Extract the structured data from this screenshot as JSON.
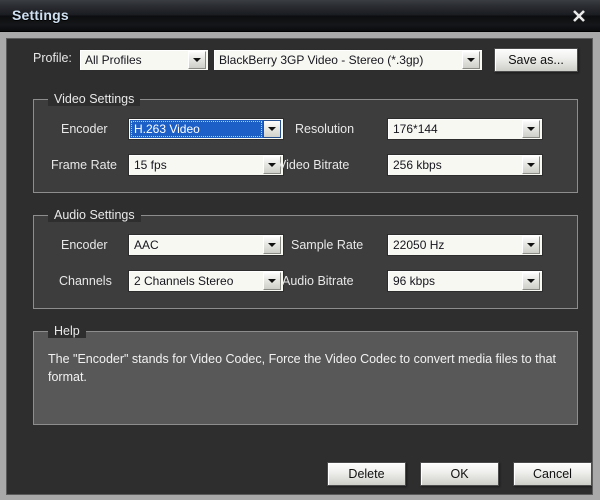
{
  "window": {
    "title": "Settings",
    "close_icon": "close-icon"
  },
  "profile": {
    "label": "Profile:",
    "filter_value": "All Profiles",
    "profile_value": "BlackBerry 3GP Video - Stereo (*.3gp)",
    "save_as_label": "Save as..."
  },
  "video_settings": {
    "title": "Video Settings",
    "encoder_label": "Encoder",
    "encoder_value": "H.263 Video",
    "resolution_label": "Resolution",
    "resolution_value": "176*144",
    "frame_rate_label": "Frame Rate",
    "frame_rate_value": "15 fps",
    "video_bitrate_label": "Video Bitrate",
    "video_bitrate_value": "256 kbps"
  },
  "audio_settings": {
    "title": "Audio Settings",
    "encoder_label": "Encoder",
    "encoder_value": "AAC",
    "sample_rate_label": "Sample Rate",
    "sample_rate_value": "22050 Hz",
    "channels_label": "Channels",
    "channels_value": "2 Channels Stereo",
    "audio_bitrate_label": "Audio Bitrate",
    "audio_bitrate_value": "96 kbps"
  },
  "help": {
    "title": "Help",
    "text": "The \"Encoder\" stands for Video Codec, Force the Video Codec to convert media files to that format."
  },
  "footer": {
    "delete_label": "Delete",
    "ok_label": "OK",
    "cancel_label": "Cancel"
  },
  "colors": {
    "accent_selection": "#1c5fc6",
    "dialog_background": "#2e2e2e",
    "group_background": "#3d3d3d",
    "help_background": "#585858",
    "frame": "#a9a9a9",
    "title_text": "#cfe0f2"
  }
}
